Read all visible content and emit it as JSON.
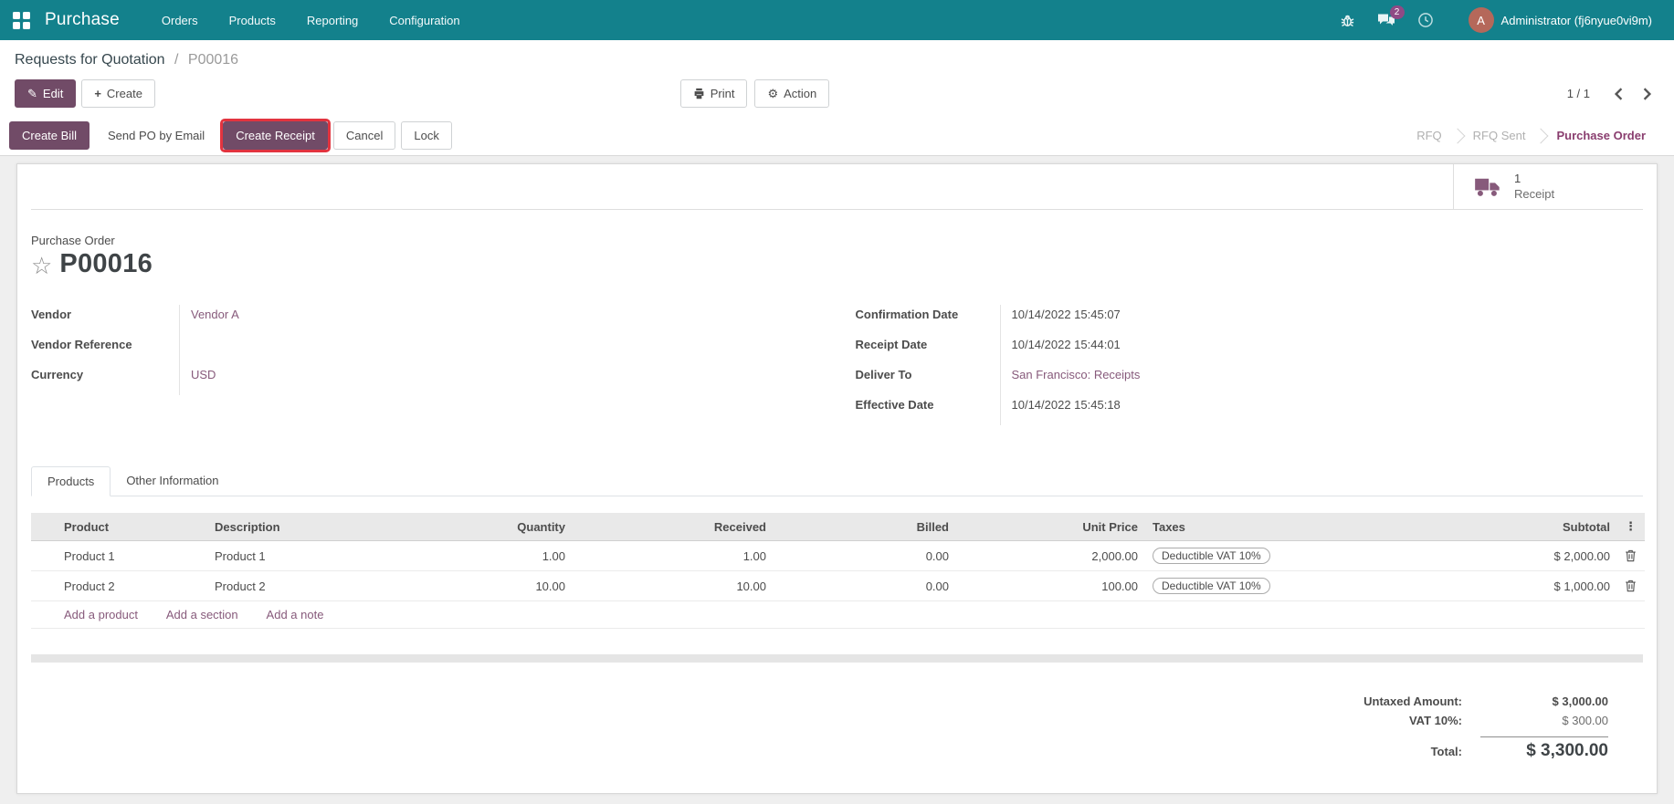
{
  "navbar": {
    "app_name": "Purchase",
    "menus": [
      "Orders",
      "Products",
      "Reporting",
      "Configuration"
    ],
    "message_badge": "2",
    "avatar_initial": "A",
    "user_name": "Administrator (fj6nyue0vi9m)"
  },
  "breadcrumb": {
    "parent": "Requests for Quotation",
    "separator": "/",
    "current": "P00016"
  },
  "control_panel": {
    "edit_label": "Edit",
    "create_label": "Create",
    "print_label": "Print",
    "action_label": "Action",
    "pager": "1 / 1"
  },
  "statusbar": {
    "create_bill": "Create Bill",
    "send_po": "Send PO by Email",
    "create_receipt": "Create Receipt",
    "cancel": "Cancel",
    "lock": "Lock",
    "states": [
      {
        "label": "RFQ",
        "active": false
      },
      {
        "label": "RFQ Sent",
        "active": false
      },
      {
        "label": "Purchase Order",
        "active": true
      }
    ]
  },
  "stat_button": {
    "value": "1",
    "label": "Receipt"
  },
  "form": {
    "doc_type": "Purchase Order",
    "title": "P00016",
    "fields_left": [
      {
        "label": "Vendor",
        "value": "Vendor A"
      },
      {
        "label": "Vendor Reference",
        "value": ""
      },
      {
        "label": "Currency",
        "value": "USD"
      }
    ],
    "fields_right": [
      {
        "label": "Confirmation Date",
        "value": "10/14/2022 15:45:07"
      },
      {
        "label": "Receipt Date",
        "value": "10/14/2022 15:44:01"
      },
      {
        "label": "Deliver To",
        "value": "San Francisco: Receipts"
      },
      {
        "label": "Effective Date",
        "value": "10/14/2022 15:45:18"
      }
    ]
  },
  "tabs": [
    {
      "label": "Products",
      "active": true
    },
    {
      "label": "Other Information",
      "active": false
    }
  ],
  "table": {
    "headers": {
      "product": "Product",
      "description": "Description",
      "quantity": "Quantity",
      "received": "Received",
      "billed": "Billed",
      "unit_price": "Unit Price",
      "taxes": "Taxes",
      "subtotal": "Subtotal",
      "options_icon": "⋮"
    },
    "rows": [
      {
        "product": "Product 1",
        "description": "Product 1",
        "quantity": "1.00",
        "received": "1.00",
        "billed": "0.00",
        "unit_price": "2,000.00",
        "taxes": "Deductible VAT 10%",
        "subtotal": "$ 2,000.00"
      },
      {
        "product": "Product 2",
        "description": "Product 2",
        "quantity": "10.00",
        "received": "10.00",
        "billed": "0.00",
        "unit_price": "100.00",
        "taxes": "Deductible VAT 10%",
        "subtotal": "$ 1,000.00"
      }
    ],
    "footer_links": [
      "Add a product",
      "Add a section",
      "Add a note"
    ]
  },
  "totals": {
    "untaxed_label": "Untaxed Amount:",
    "untaxed_value": "$ 3,000.00",
    "vat_label": "VAT 10%:",
    "vat_value": "$ 300.00",
    "total_label": "Total:",
    "total_value": "$ 3,300.00"
  },
  "colors": {
    "navbar": "#13818c",
    "primary": "#714b67",
    "link": "#875a7b",
    "highlight_border": "#e2343f",
    "avatar_bg": "#b5685a",
    "badge_bg": "#8f4a85"
  }
}
